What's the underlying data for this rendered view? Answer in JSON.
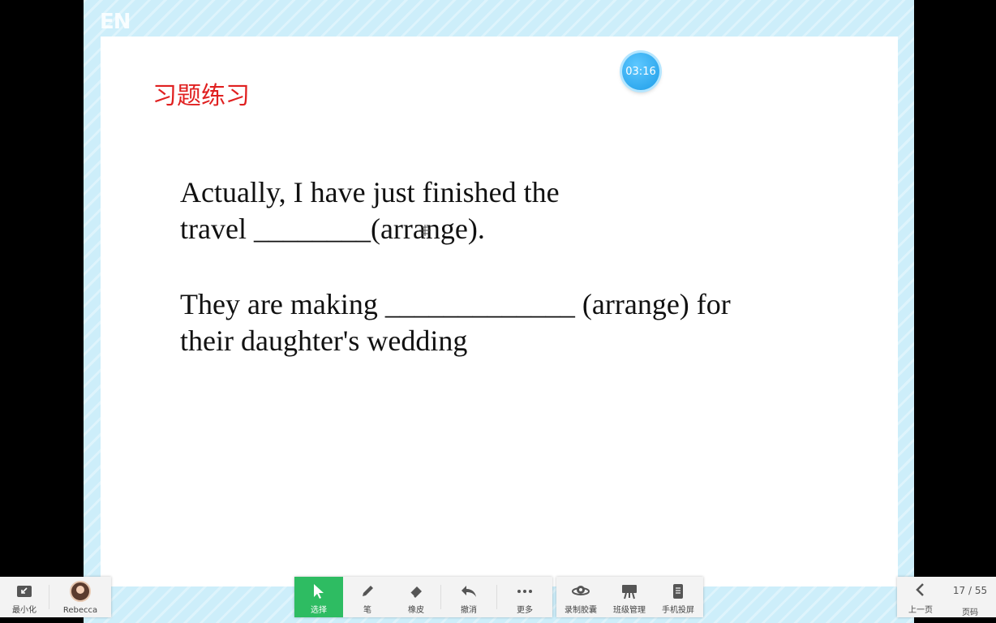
{
  "background": {
    "logo": "EN"
  },
  "slide": {
    "timer": "03:16",
    "title": "习题练习",
    "questions": [
      {
        "lines": [
          "Actually, I have just finished the",
          "travel ________(arrange)."
        ]
      },
      {
        "lines": [
          "They are making _____________ (arrange) for",
          "their daughter's wedding"
        ]
      }
    ]
  },
  "toolbar_left": {
    "minimize": {
      "label": "最小化",
      "icon": "minimize-icon"
    },
    "user": {
      "label": "Rebecca",
      "icon": "avatar"
    }
  },
  "toolbar_center": {
    "select": {
      "label": "选择",
      "icon": "pointer-icon"
    },
    "pen": {
      "label": "笔",
      "icon": "pen-icon"
    },
    "eraser": {
      "label": "橡皮",
      "icon": "eraser-icon"
    },
    "undo": {
      "label": "撤消",
      "icon": "undo-icon"
    },
    "more": {
      "label": "更多",
      "icon": "more-icon"
    }
  },
  "toolbar_right": {
    "record": {
      "label": "录制胶囊",
      "icon": "record-icon"
    },
    "class": {
      "label": "班级管理",
      "icon": "class-icon"
    },
    "phone": {
      "label": "手机投屏",
      "icon": "phone-icon"
    }
  },
  "pager": {
    "prev_label": "上一页",
    "page_text": "17 / 55",
    "page_label": "页码"
  },
  "colors": {
    "accent": "#2ebc62",
    "title": "#e02020",
    "timer": "#1e9de8"
  }
}
